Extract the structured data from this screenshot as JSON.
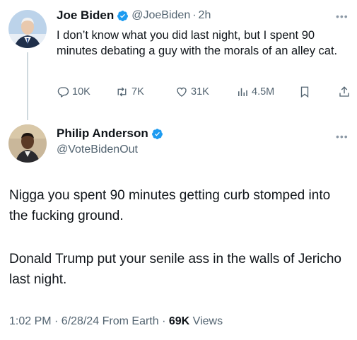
{
  "reply_to": {
    "author_name": "Joe Biden",
    "handle": "@JoeBiden",
    "separator": "·",
    "time": "2h",
    "text": "I don’t know what you did last night, but I spent 90 minutes debating a guy with the morals of an alley cat.",
    "stats": {
      "replies": "10K",
      "reposts": "7K",
      "likes": "31K",
      "views": "4.5M"
    }
  },
  "main_tweet": {
    "author_name": "Philip Anderson",
    "handle": "@VoteBidenOut",
    "paragraph1": "Nigga you spent 90 minutes getting curb stomped into the fucking ground.",
    "paragraph2": "Donald Trump put your senile ass in the walls of Jericho last night.",
    "timestamp": "1:02 PM · 6/28/24 From Earth · ",
    "views_count": "69K",
    "views_label": " Views"
  },
  "icons": {
    "verified": "verified-badge-icon",
    "more": "more-options-icon",
    "reply": "reply-icon",
    "repost": "repost-icon",
    "like": "heart-icon",
    "views": "analytics-icon",
    "bookmark": "bookmark-icon",
    "share": "share-icon"
  },
  "colors": {
    "verified": "#1d9bf0",
    "text_primary": "#0f1419",
    "text_secondary": "#536471"
  }
}
